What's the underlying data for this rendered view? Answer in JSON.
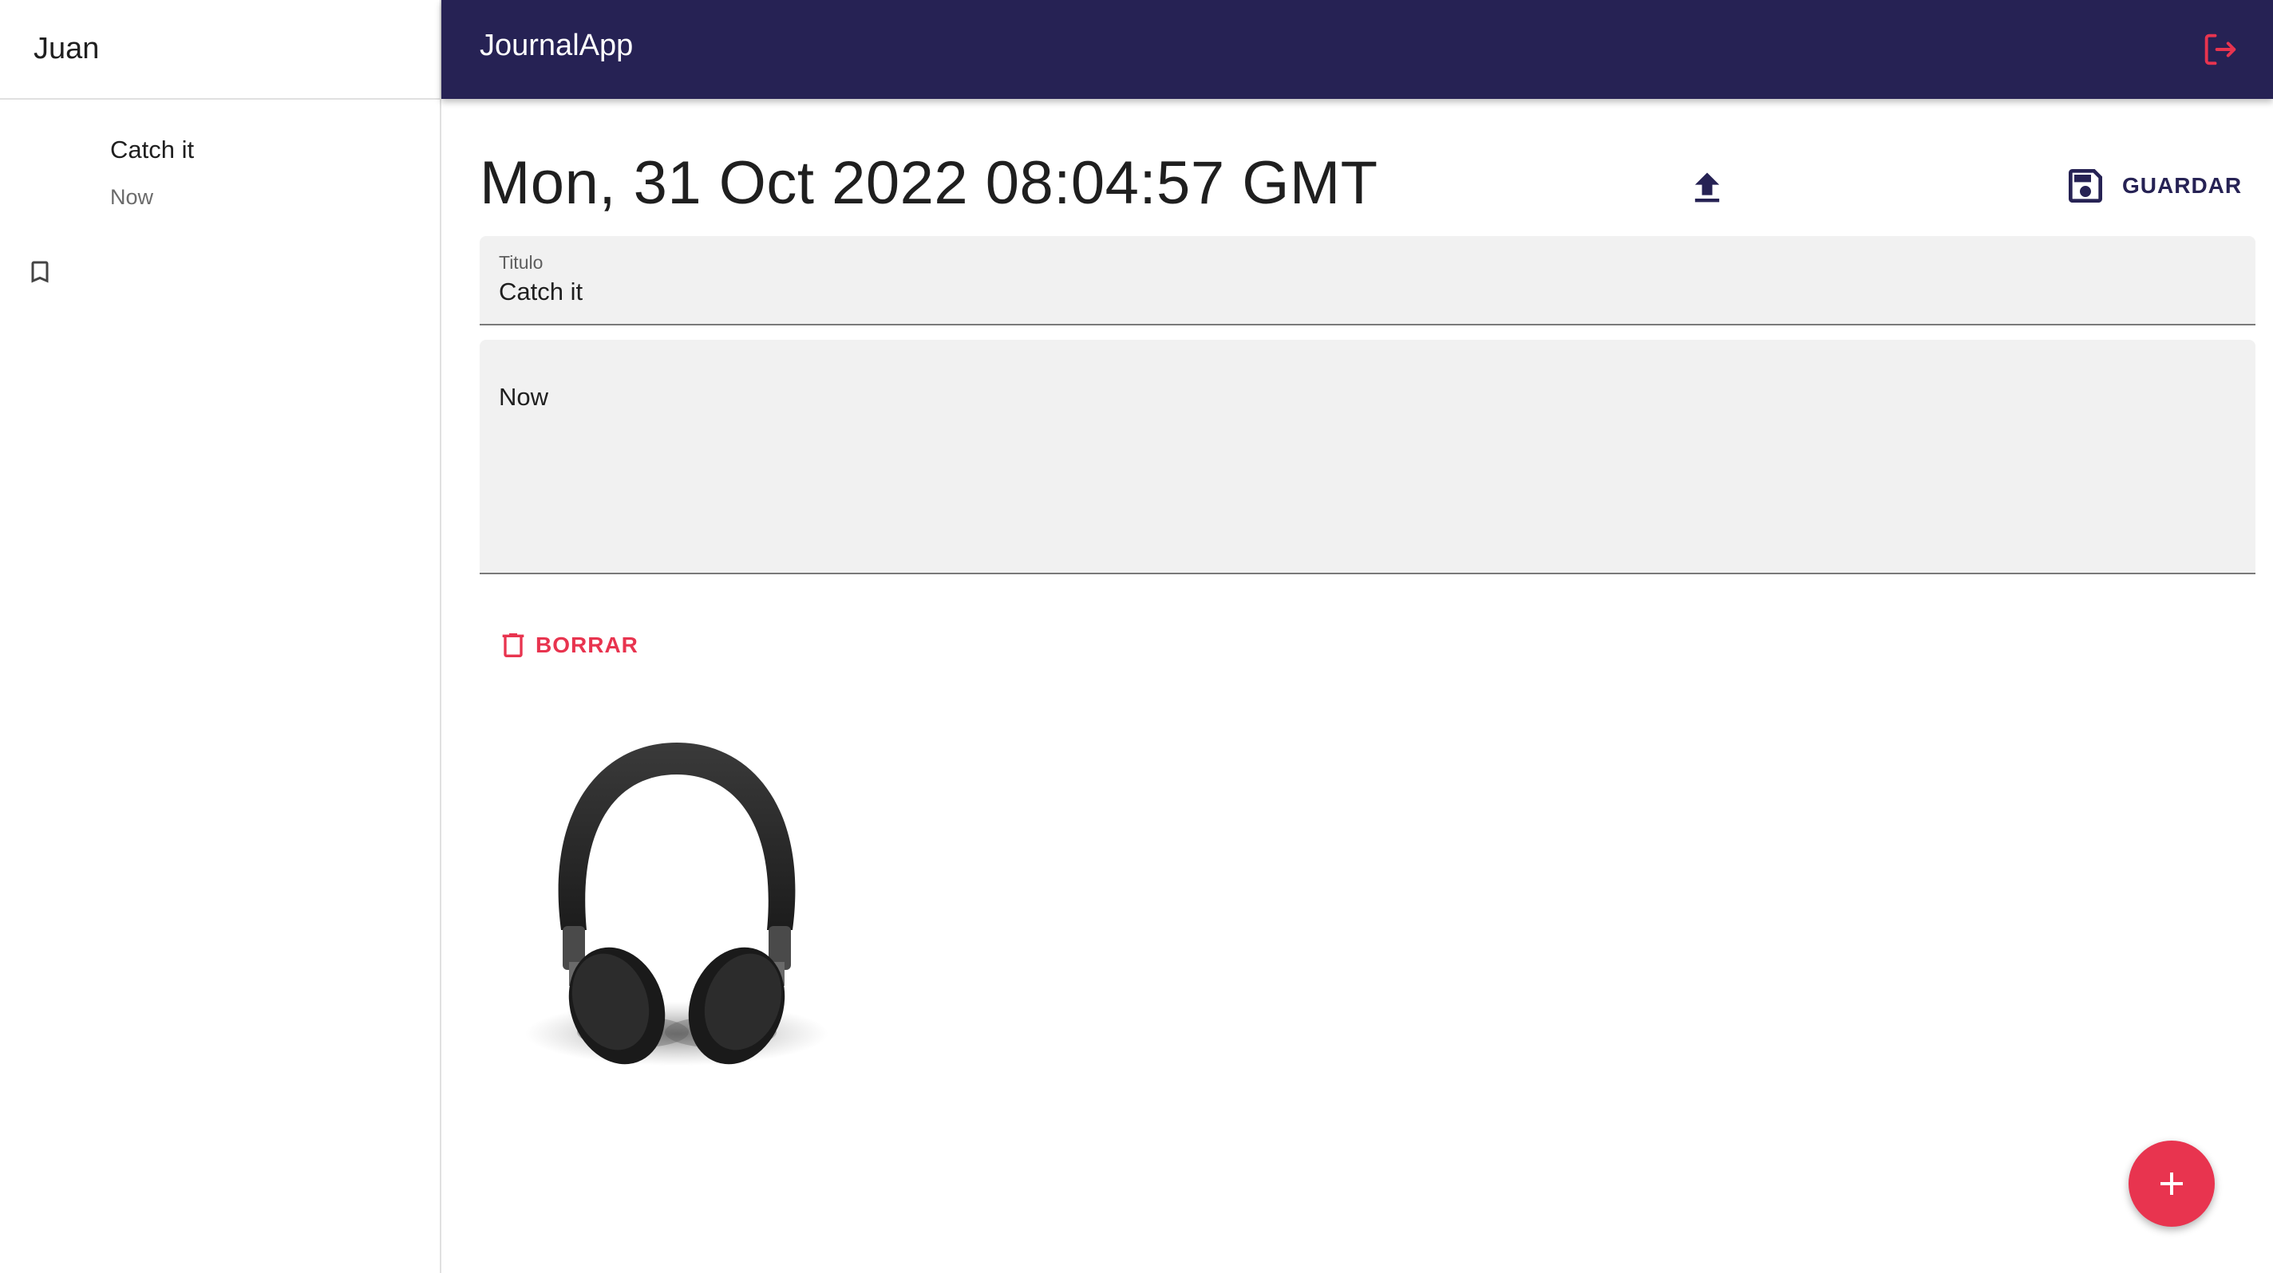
{
  "sidebar": {
    "user_name": "Juan",
    "notes": [
      {
        "title": "Catch it",
        "body": "Now",
        "icon": "bookmark-icon"
      }
    ]
  },
  "topbar": {
    "app_title": "JournalApp",
    "logout_icon": "logout-icon"
  },
  "note": {
    "date": "Mon, 31 Oct 2022 08:04:57 GMT",
    "upload_icon": "upload-icon",
    "save_label": "GUARDAR",
    "title_label": "Titulo",
    "title_value": "Catch it",
    "body_value": "Now",
    "delete_label": "BORRAR",
    "image": "headphones-image"
  },
  "fab": {
    "icon": "add-icon"
  },
  "colors": {
    "topbar": "#262254",
    "accent": "#e8344f",
    "field_bg": "#f1f1f1"
  }
}
